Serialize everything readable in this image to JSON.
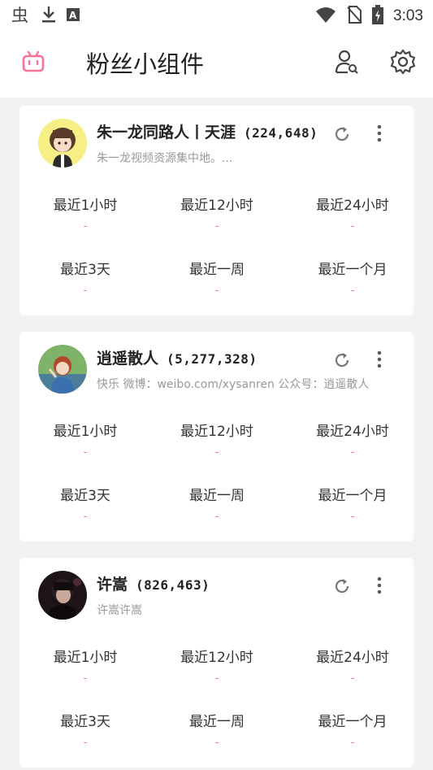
{
  "status_bar": {
    "time": "3:03",
    "left_icons": [
      "bug-icon",
      "download-icon",
      "a-box-icon"
    ],
    "right_icons": [
      "wifi-icon",
      "no-sim-icon",
      "battery-charging-icon"
    ]
  },
  "app_bar": {
    "title": "粉丝小组件",
    "logo_icon": "bilibili-tv-icon",
    "logo_color": "#fb7299",
    "actions": [
      "user-search-icon",
      "settings-gear-icon"
    ]
  },
  "cards": [
    {
      "name": "朱一龙同路人丨天涯",
      "fans": "(224,648)",
      "desc": "朱一龙视频资源集中地。...",
      "stats": [
        {
          "label": "最近1小时",
          "value": "-"
        },
        {
          "label": "最近12小时",
          "value": "-"
        },
        {
          "label": "最近24小时",
          "value": "-"
        },
        {
          "label": "最近3天",
          "value": "-"
        },
        {
          "label": "最近一周",
          "value": "-"
        },
        {
          "label": "最近一个月",
          "value": "-"
        }
      ]
    },
    {
      "name": "逍遥散人",
      "fans": "(5,277,328)",
      "desc": "快乐 微博：weibo.com/xysanren 公众号：逍遥散人",
      "stats": [
        {
          "label": "最近1小时",
          "value": "-"
        },
        {
          "label": "最近12小时",
          "value": "-"
        },
        {
          "label": "最近24小时",
          "value": "-"
        },
        {
          "label": "最近3天",
          "value": "-"
        },
        {
          "label": "最近一周",
          "value": "-"
        },
        {
          "label": "最近一个月",
          "value": "-"
        }
      ]
    },
    {
      "name": "许嵩",
      "fans": "(826,463)",
      "desc": "许嵩许嵩",
      "stats": [
        {
          "label": "最近1小时",
          "value": "-"
        },
        {
          "label": "最近12小时",
          "value": "-"
        },
        {
          "label": "最近24小时",
          "value": "-"
        },
        {
          "label": "最近3天",
          "value": "-"
        },
        {
          "label": "最近一周",
          "value": "-"
        },
        {
          "label": "最近一个月",
          "value": "-"
        }
      ]
    }
  ],
  "colors": {
    "accent": "#fb7299",
    "stat_value": "#e8768c",
    "background": "#f2f2f2"
  }
}
